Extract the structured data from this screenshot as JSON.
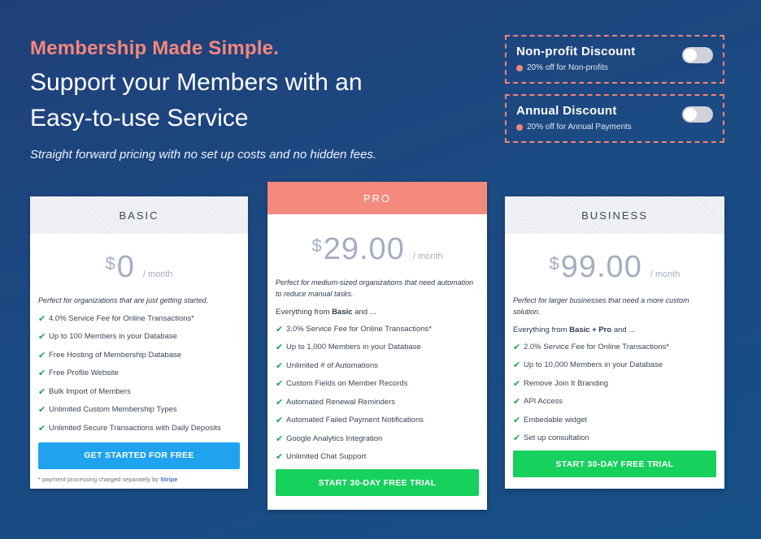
{
  "hero": {
    "eyebrow": "Membership Made Simple.",
    "headline_line1": "Support your Members with an",
    "headline_line2": "Easy-to-use Service",
    "subline": "Straight forward pricing with no set up costs and no hidden fees."
  },
  "discounts": [
    {
      "title": "Non-profit Discount",
      "note": "20% off for Non-profits",
      "enabled": false
    },
    {
      "title": "Annual Discount",
      "note": "20% off for Annual Payments",
      "enabled": false
    }
  ],
  "plans": {
    "basic": {
      "name": "BASIC",
      "currency": "$",
      "price": "0",
      "period": "/ month",
      "description": "Perfect for organizations that are just getting started.",
      "features": [
        "4.0% Service Fee for Online Transactions*",
        "Up to 100 Members in your Database",
        "Free Hosting of Membership Database",
        "Free Profile Website",
        "Bulk Import of Members",
        "Unlimited Custom Membership Types",
        "Unlimited Secure Transactions with Daily Deposits"
      ],
      "cta": "GET STARTED FOR FREE",
      "footnote": "* payment processing charged separately by",
      "footnote_link": "Stripe"
    },
    "pro": {
      "name": "PRO",
      "currency": "$",
      "price": "29.00",
      "period": "/ month",
      "description": "Perfect for medium-sized organizations that need automation to reduce manual tasks.",
      "intro_prefix": "Everything from ",
      "intro_bold": "Basic",
      "intro_suffix": " and ...",
      "features": [
        "3.0% Service Fee for Online Transactions*",
        "Up to 1,000 Members in your Database",
        "Unlimited # of Automations",
        "Custom Fields on Member Records",
        "Automated Renewal Reminders",
        "Automated Failed Payment Notifications",
        "Google Analytics Integration",
        "Unlimited Chat Support"
      ],
      "cta": "START 30-DAY FREE TRIAL"
    },
    "business": {
      "name": "BUSINESS",
      "currency": "$",
      "price": "99.00",
      "period": "/ month",
      "description": "Perfect for larger businesses that need a more custom solution.",
      "intro_prefix": "Everything from ",
      "intro_bold": "Basic + Pro",
      "intro_suffix": " and ...",
      "features": [
        "2.0% Service Fee for Online Transactions*",
        "Up to 10,000 Members in your Database",
        "Remove Join It Branding",
        "API Access",
        "Embedable widget",
        "Set up consultation"
      ],
      "cta": "START 30-DAY FREE TRIAL"
    }
  },
  "colors": {
    "accent": "#f7877a",
    "check": "#1aa84a",
    "cta_blue": "#1fa3ef",
    "cta_green": "#16d15c"
  }
}
